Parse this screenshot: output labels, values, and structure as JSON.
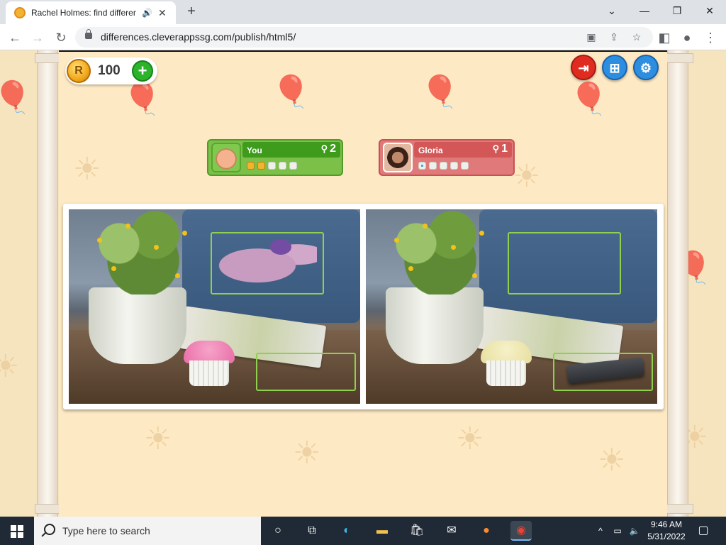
{
  "browser": {
    "tab_title": "Rachel Holmes: find differen",
    "url": "differences.cleverappssg.com/publish/html5/",
    "icons": [
      "audio-icon",
      "close-icon",
      "new-tab-icon",
      "back-icon",
      "forward-icon",
      "reload-icon",
      "lock-icon",
      "cast-icon",
      "share-icon",
      "star-icon",
      "sidebar-icon",
      "profile-icon",
      "menu-icon"
    ]
  },
  "game": {
    "coins": "100",
    "coin_symbol": "R",
    "players": [
      {
        "name": "You",
        "score": "2",
        "found": 2,
        "total": 5
      },
      {
        "name": "Gloria",
        "score": "1",
        "found": 1,
        "total": 5
      }
    ],
    "colors": {
      "you": "#3e9b1c",
      "opponent": "#d35757",
      "highlight": "#8fd14f",
      "accent": "#2d8ee0"
    }
  },
  "taskbar": {
    "search_placeholder": "Type here to search",
    "time": "9:46 AM",
    "date": "5/31/2022"
  }
}
